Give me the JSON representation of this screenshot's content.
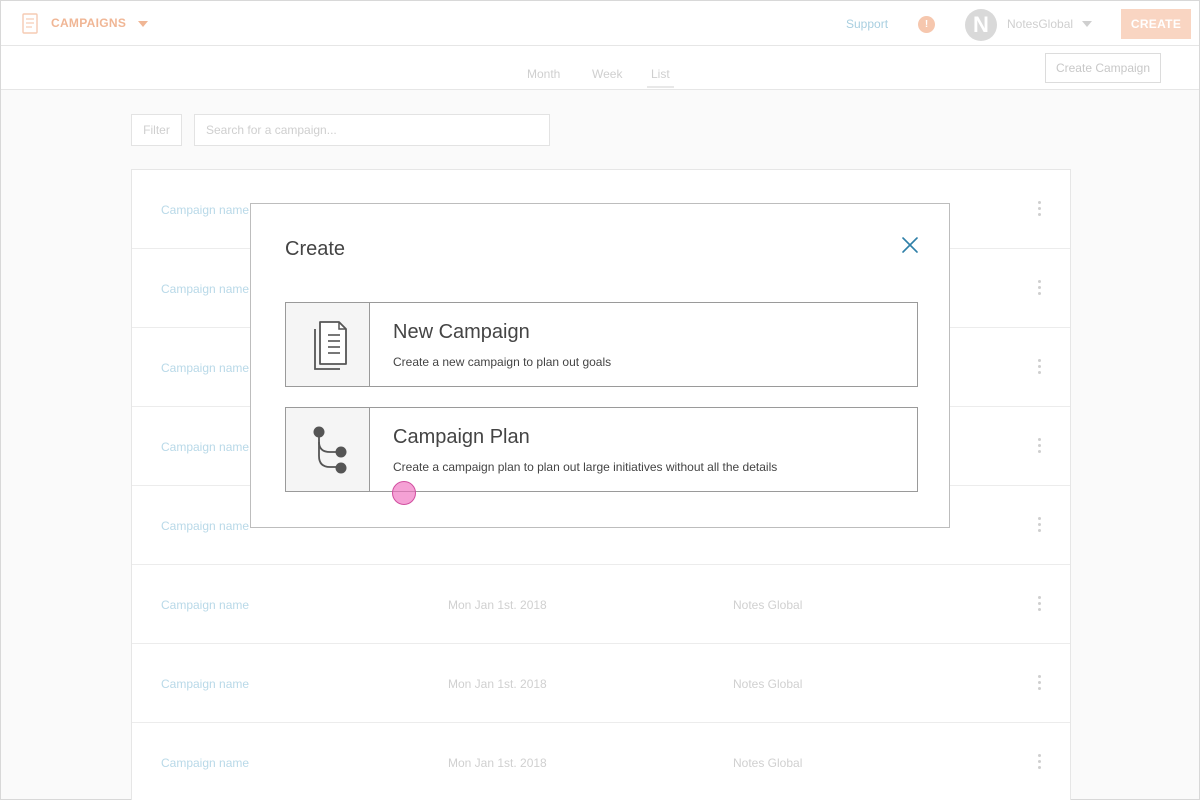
{
  "topbar": {
    "brand_label": "CAMPAIGNS",
    "support_label": "Support",
    "alert_count": "!",
    "avatar_letter": "N",
    "account_name": "NotesGlobal",
    "create_label": "CREATE"
  },
  "view_tabs": {
    "month": "Month",
    "week": "Week",
    "list": "List"
  },
  "subbar": {
    "create_campaign_label": "Create Campaign"
  },
  "toolbar": {
    "filter_label": "Filter",
    "search_placeholder": "Search for a campaign..."
  },
  "table": {
    "rows": [
      {
        "name": "Campaign name",
        "date": "",
        "owner": ""
      },
      {
        "name": "Campaign name",
        "date": "",
        "owner": ""
      },
      {
        "name": "Campaign name",
        "date": "",
        "owner": ""
      },
      {
        "name": "Campaign name",
        "date": "",
        "owner": ""
      },
      {
        "name": "Campaign name",
        "date": "",
        "owner": ""
      },
      {
        "name": "Campaign name",
        "date": "Mon Jan 1st. 2018",
        "owner": "Notes Global"
      },
      {
        "name": "Campaign name",
        "date": "Mon Jan 1st. 2018",
        "owner": "Notes Global"
      },
      {
        "name": "Campaign name",
        "date": "Mon Jan 1st. 2018",
        "owner": "Notes Global"
      }
    ]
  },
  "modal": {
    "title": "Create",
    "options": [
      {
        "title": "New Campaign",
        "description": "Create a new campaign to plan out goals",
        "icon": "document-stack-icon"
      },
      {
        "title": "Campaign Plan",
        "description": "Create a campaign plan to plan out large initiatives without all the details",
        "icon": "branch-icon"
      }
    ]
  },
  "colors": {
    "accent": "#f0b695",
    "link": "#2f7fa8",
    "cursor": "#f06ebe"
  }
}
